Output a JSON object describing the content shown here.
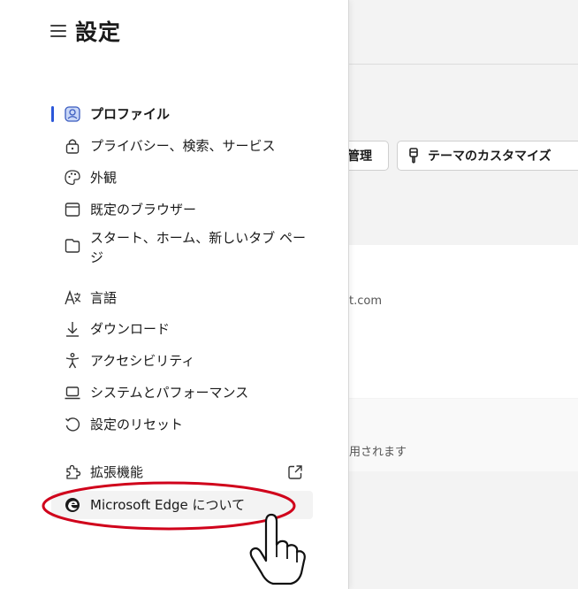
{
  "header": {
    "title": "設定",
    "menu_icon": "hamburger-icon"
  },
  "sidebar": {
    "items": [
      {
        "label": "プロファイル",
        "icon": "profile-icon",
        "active": true
      },
      {
        "label": "プライバシー、検索、サービス",
        "icon": "lock-icon"
      },
      {
        "label": "外観",
        "icon": "palette-icon"
      },
      {
        "label": "既定のブラウザー",
        "icon": "browser-window-icon"
      },
      {
        "label": "スタート、ホーム、新しいタブ ページ",
        "icon": "tab-page-icon"
      },
      {
        "label": "言語",
        "icon": "language-icon"
      },
      {
        "label": "ダウンロード",
        "icon": "download-icon"
      },
      {
        "label": "アクセシビリティ",
        "icon": "accessibility-icon"
      },
      {
        "label": "システムとパフォーマンス",
        "icon": "laptop-icon"
      },
      {
        "label": "設定のリセット",
        "icon": "reset-icon"
      },
      {
        "label": "拡張機能",
        "icon": "extensions-icon",
        "external_icon": "external-link-icon"
      },
      {
        "label": "Microsoft Edge について",
        "icon": "edge-logo-icon",
        "highlighted": true
      }
    ]
  },
  "background": {
    "manage_button": "管理",
    "theme_button": "テーマのカスタマイズ",
    "email_fragment": "t.com",
    "used_text": "用されます"
  },
  "colors": {
    "accent": "#2b57d9",
    "annotation": "#d0021b"
  }
}
